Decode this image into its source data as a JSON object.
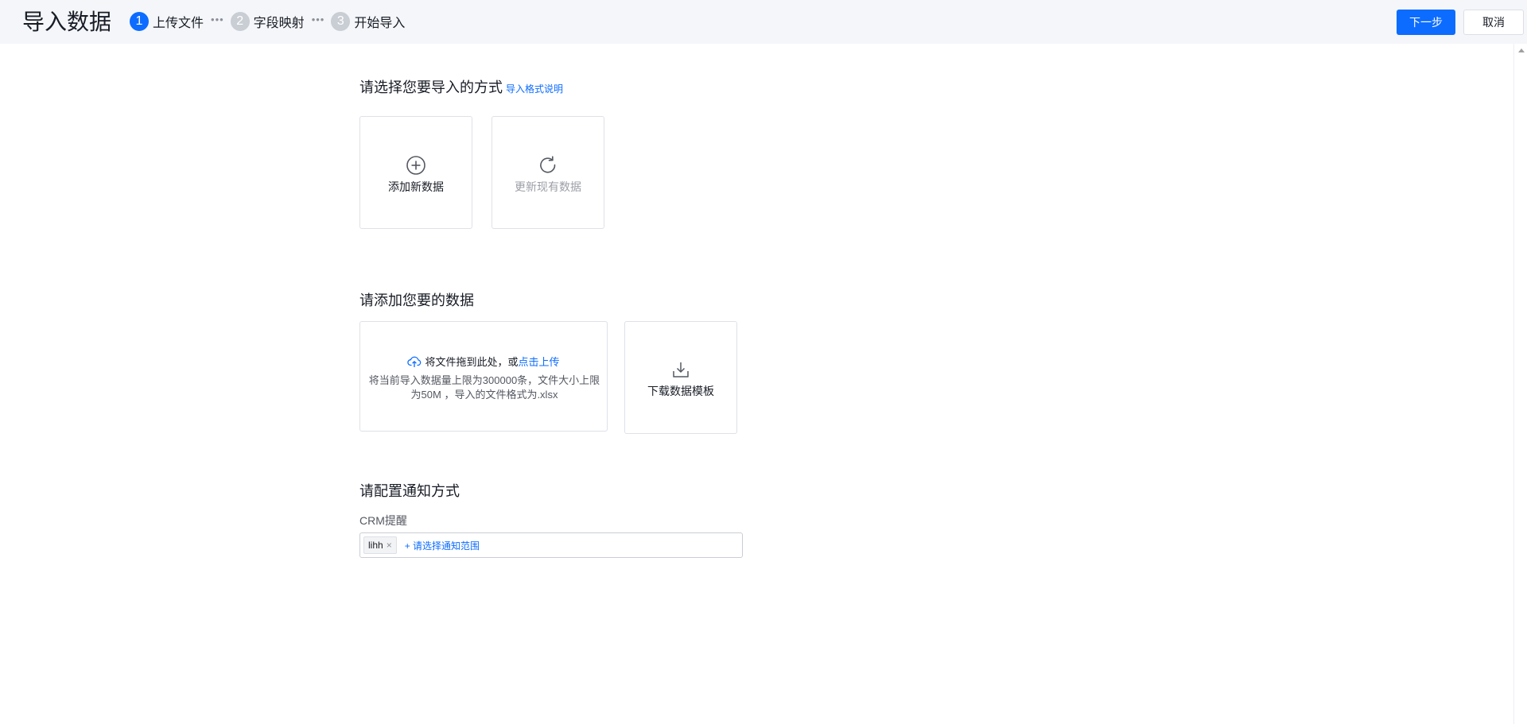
{
  "header": {
    "title": "导入数据",
    "steps": [
      {
        "num": "1",
        "label": "上传文件"
      },
      {
        "num": "2",
        "label": "字段映射"
      },
      {
        "num": "3",
        "label": "开始导入"
      }
    ],
    "step_separator": "•••",
    "next_label": "下一步",
    "cancel_label": "取消"
  },
  "method": {
    "title": "请选择您要导入的方式",
    "help_link": "导入格式说明",
    "options": [
      {
        "label": "添加新数据",
        "icon": "plus-circle-icon"
      },
      {
        "label": "更新现有数据",
        "icon": "refresh-icon"
      }
    ]
  },
  "upload": {
    "title": "请添加您要的数据",
    "drag_text": "将文件拖到此处，或",
    "click_text": "点击上传",
    "desc": "将当前导入数据量上限为300000条，文件大小上限为50M ，导入的文件格式为.xlsx",
    "template_label": "下载数据模板"
  },
  "notify": {
    "title": "请配置通知方式",
    "field_label": "CRM提醒",
    "tag": "lihh",
    "tag_close": "×",
    "add_label": "+ 请选择通知范围"
  },
  "colors": {
    "accent": "#0c6cff",
    "header_bg": "#f4f6f9",
    "disabled_text": "#9b9ea6"
  }
}
